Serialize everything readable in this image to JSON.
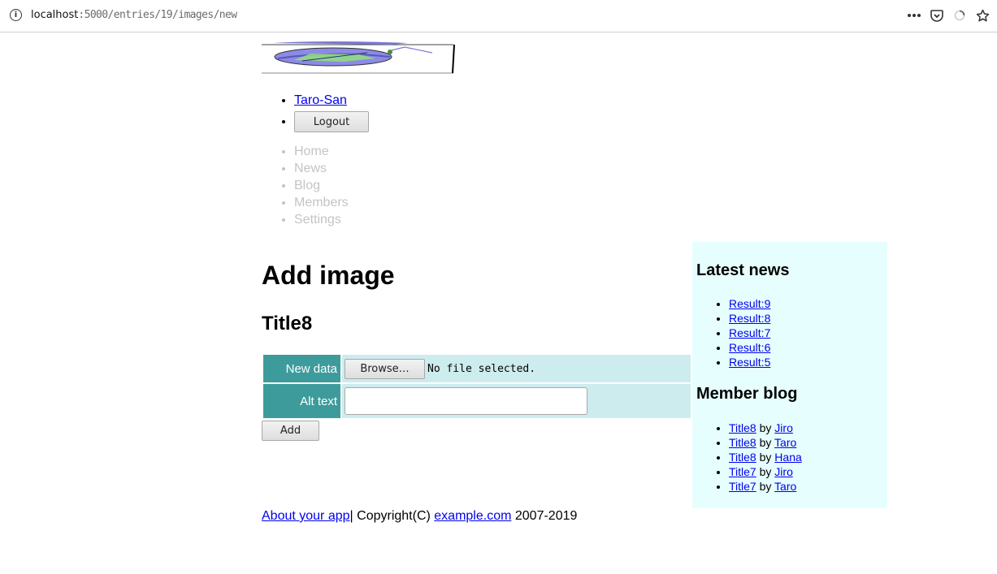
{
  "browser": {
    "host": "localhost",
    "path": ":5000/entries/19/images/new"
  },
  "user_menu": {
    "username": "Taro-San",
    "logout_label": "Logout"
  },
  "main_menu": [
    "Home",
    "News",
    "Blog",
    "Members",
    "Settings"
  ],
  "page": {
    "heading": "Add image",
    "entry_title": "Title8"
  },
  "form": {
    "new_data_label": "New data",
    "browse_label": "Browse…",
    "no_file_text": "No file selected.",
    "alt_text_label": "Alt text",
    "alt_text_value": "",
    "submit_label": "Add"
  },
  "sidebar": {
    "news_heading": "Latest news",
    "news_items": [
      "Result:9",
      "Result:8",
      "Result:7",
      "Result:6",
      "Result:5"
    ],
    "blog_heading": "Member blog",
    "blog_items": [
      {
        "title": "Title8",
        "by": "by",
        "author": "Jiro"
      },
      {
        "title": "Title8",
        "by": "by",
        "author": "Taro"
      },
      {
        "title": "Title8",
        "by": "by",
        "author": "Hana"
      },
      {
        "title": "Title7",
        "by": "by",
        "author": "Jiro"
      },
      {
        "title": "Title7",
        "by": "by",
        "author": "Taro"
      }
    ]
  },
  "footer": {
    "about_link": "About your app",
    "separator_copyright": "| Copyright(C) ",
    "site_link": "example.com",
    "years": " 2007-2019"
  },
  "colors": {
    "form_header_bg": "#3e9b9c",
    "form_cell_bg": "#cdecee",
    "sidebar_bg": "#e6fffe",
    "menu_disabled": "#c4c4c4",
    "link": "#0000ee"
  }
}
